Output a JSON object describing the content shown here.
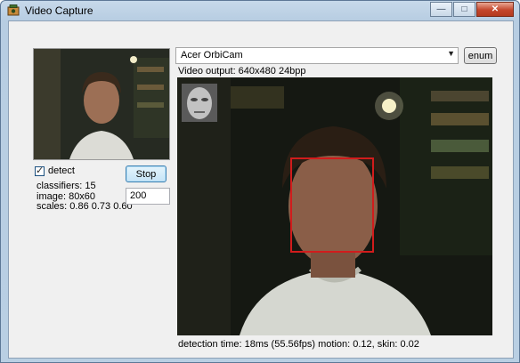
{
  "window": {
    "title": "Video Capture",
    "app_icon": "webcam-app-icon",
    "buttons": {
      "minimize": "—",
      "maximize": "□",
      "close": "✕"
    }
  },
  "left_panel": {
    "detect_label": "detect",
    "detect_checked": true,
    "stop_label": "Stop",
    "threshold_value": "200",
    "stats": {
      "classifiers": "classifiers: 15",
      "image": "image: 80x60",
      "scales": "scales: 0.86 0.73 0.60"
    }
  },
  "device": {
    "selected": "Acer OrbiCam",
    "enum_label": "enum"
  },
  "video": {
    "output_info": "Video output: 640x480 24bpp"
  },
  "status": {
    "text": "detection time: 18ms (55.56fps)  motion: 0.12, skin: 0.02"
  },
  "colors": {
    "detection_box": "#d11c1c",
    "window_frame": "#b9cfe3"
  }
}
